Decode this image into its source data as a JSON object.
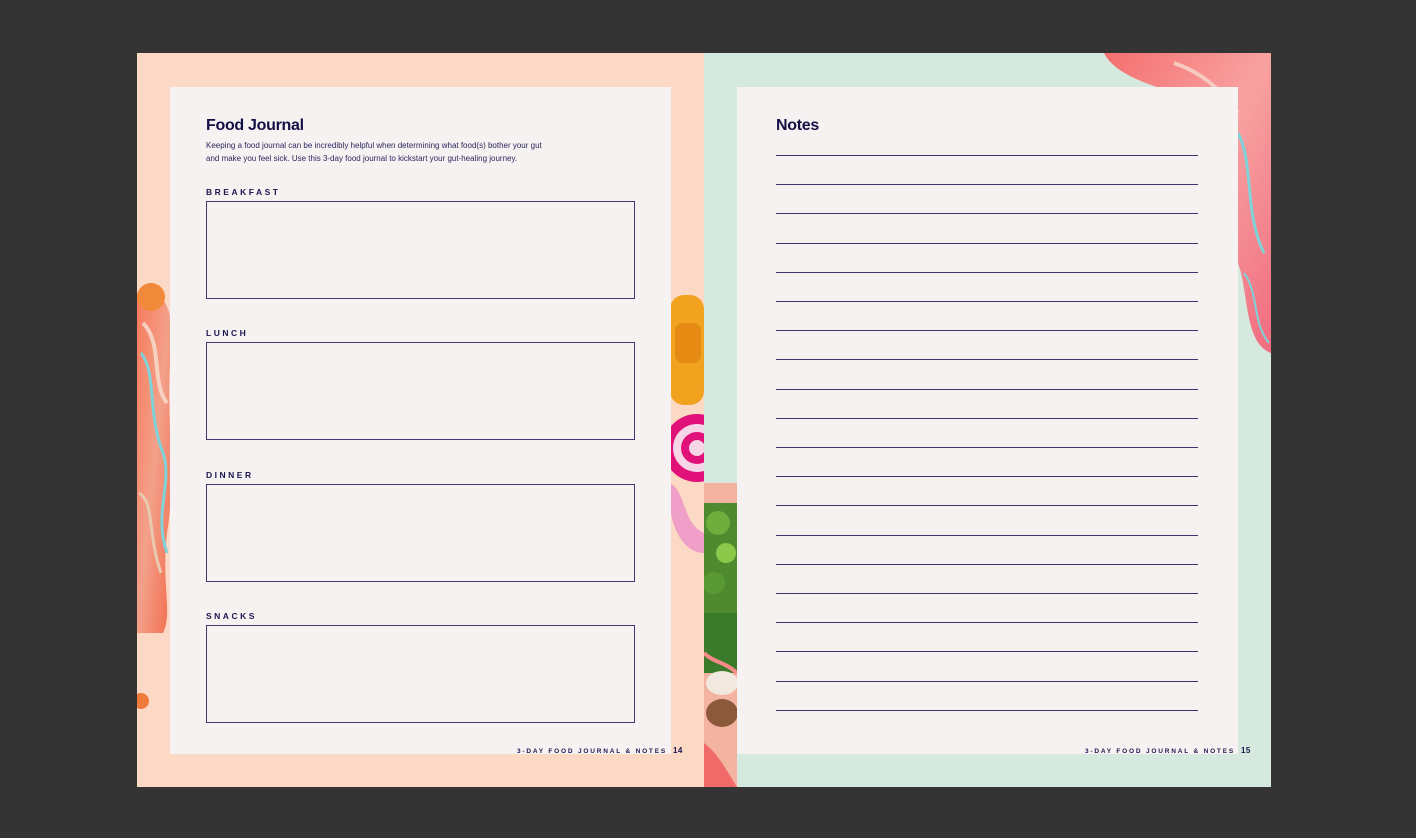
{
  "left_page": {
    "title": "Food Journal",
    "intro_line1": "Keeping a food journal can be incredibly helpful when determining what food(s) bother your gut",
    "intro_line2": "and make you feel sick. Use this 3-day food journal to kickstart your gut-healing journey.",
    "meals": [
      {
        "label": "BREAKFAST"
      },
      {
        "label": "LUNCH"
      },
      {
        "label": "DINNER"
      },
      {
        "label": "SNACKS"
      }
    ],
    "footer_text": "3-DAY FOOD JOURNAL & NOTES",
    "page_number": "14"
  },
  "right_page": {
    "title": "Notes",
    "line_count": 20,
    "footer_text": "3-DAY FOOD JOURNAL & NOTES",
    "page_number": "15"
  },
  "colors": {
    "ink": "#131046",
    "left_background": "#fbd9c5",
    "right_background": "#d5e9df",
    "sheet": "#f6f2f1"
  }
}
